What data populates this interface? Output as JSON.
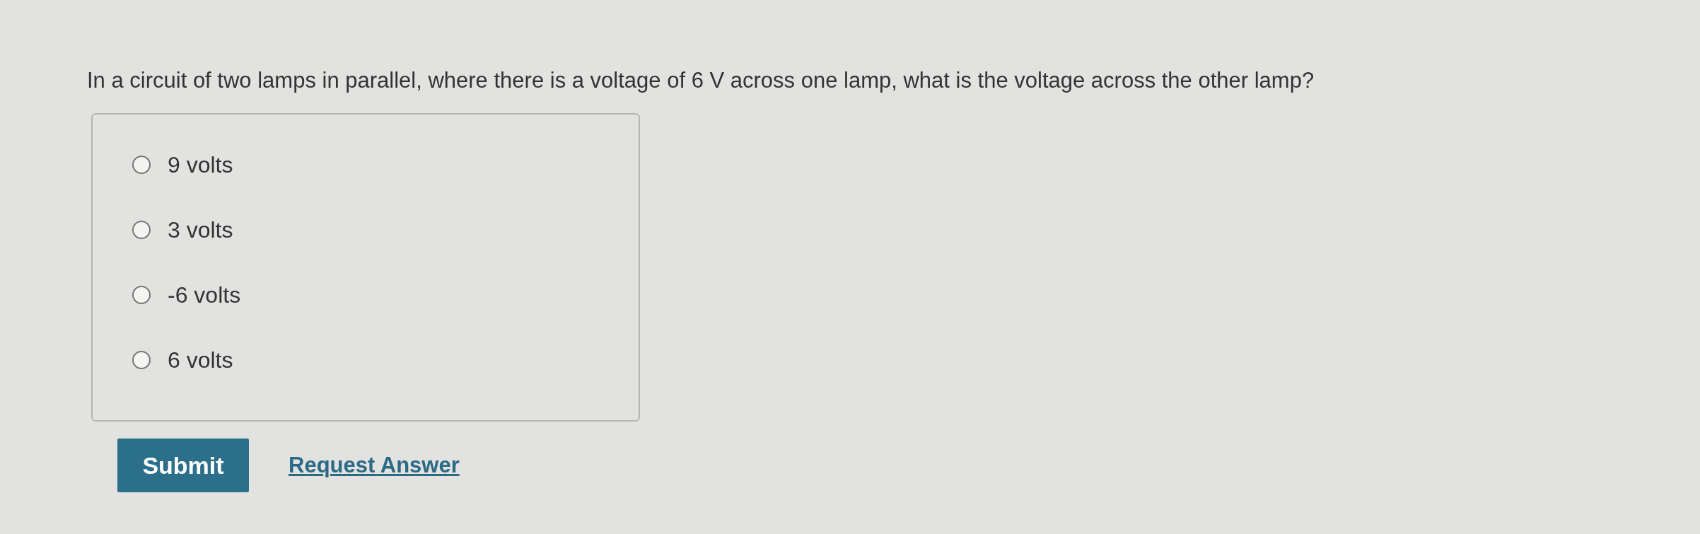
{
  "question": "In a circuit of two lamps in parallel, where there is a voltage of 6 V across one lamp, what is the voltage across the other lamp?",
  "options": [
    {
      "label": "9 volts",
      "selected": false
    },
    {
      "label": "3 volts",
      "selected": false
    },
    {
      "label": "-6 volts",
      "selected": false
    },
    {
      "label": "6 volts",
      "selected": false
    }
  ],
  "submit": "Submit",
  "request_answer": "Request Answer"
}
